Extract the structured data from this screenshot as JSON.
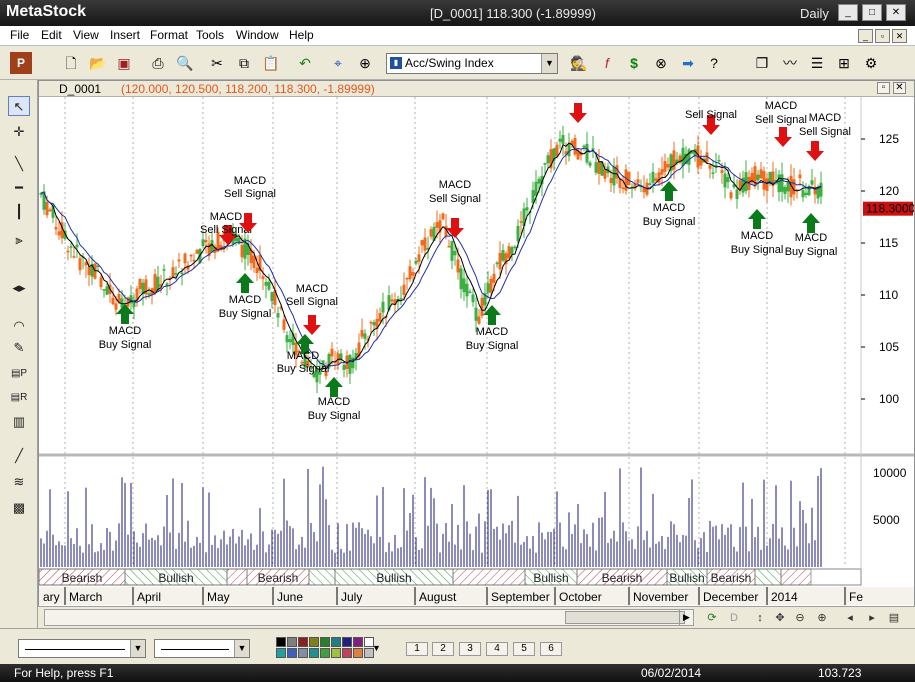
{
  "app": {
    "title": "MetaStock",
    "title_prefix": "Meta",
    "title_suffix": "Stock",
    "document": "[D_0001]   118.300 (-1.89999)",
    "periodicity": "Daily",
    "window_buttons": [
      "_",
      "□",
      "✕"
    ]
  },
  "menu": {
    "items": [
      "File",
      "Edit",
      "View",
      "Insert",
      "Format",
      "Tools",
      "Window",
      "Help"
    ]
  },
  "toolbar": {
    "indicator_combo_value": "Acc/Swing Index"
  },
  "chart": {
    "header_symbol": "D_0001",
    "header_values": "(120.000, 120.500, 118.200, 118.300, -1.89999)",
    "last_price_tag": "118.3000",
    "price_axis": [
      "125",
      "120",
      "115",
      "110",
      "105",
      "100"
    ],
    "volume_axis": [
      "10000",
      "5000"
    ],
    "months": [
      "ary",
      "March",
      "April",
      "May",
      "June",
      "July",
      "August",
      "September",
      "October",
      "November",
      "December",
      "2014",
      "Fe"
    ],
    "trend_bands": [
      {
        "label": "Bearish",
        "kind": "bear"
      },
      {
        "label": "Bullish",
        "kind": "bull"
      },
      {
        "label": "",
        "kind": "bear"
      },
      {
        "label": "Bearish",
        "kind": "bear"
      },
      {
        "label": "",
        "kind": "bull"
      },
      {
        "label": "Bullish",
        "kind": "bull"
      },
      {
        "label": "",
        "kind": "bear"
      },
      {
        "label": "Bullish",
        "kind": "bull"
      },
      {
        "label": "Bearish",
        "kind": "bear"
      },
      {
        "label": "Bullish",
        "kind": "bull"
      },
      {
        "label": "Bearish",
        "kind": "bear"
      },
      {
        "label": "",
        "kind": "bull"
      },
      {
        "label": "",
        "kind": "bear"
      }
    ],
    "signals": [
      {
        "type": "buy",
        "line1": "MACD",
        "line2": "Buy Signal"
      },
      {
        "type": "sell",
        "line1": "MACD",
        "line2": "Sell Signal"
      },
      {
        "type": "sell",
        "line1": "MACD",
        "line2": "Sell Signal"
      },
      {
        "type": "buy",
        "line1": "MACD",
        "line2": "Buy Signal"
      },
      {
        "type": "sell",
        "line1": "MACD",
        "line2": "Sell Signal"
      },
      {
        "type": "buy",
        "line1": "MACD",
        "line2": "Buy Signal"
      },
      {
        "type": "buy",
        "line1": "MACD",
        "line2": "Buy Signal"
      },
      {
        "type": "sell",
        "line1": "MACD",
        "line2": "Sell Signal"
      },
      {
        "type": "buy",
        "line1": "MACD",
        "line2": "Buy Signal"
      },
      {
        "type": "sell",
        "line1": "",
        "line2": ""
      },
      {
        "type": "buy",
        "line1": "MACD",
        "line2": "Buy Signal"
      },
      {
        "type": "sell",
        "line1": "",
        "line2": "Sell Signal"
      },
      {
        "type": "buy",
        "line1": "MACD",
        "line2": "Buy Signal"
      },
      {
        "type": "sell",
        "line1": "MACD",
        "line2": "Sell Signal"
      },
      {
        "type": "sell",
        "line1": "MACD",
        "line2": "Sell Signal"
      },
      {
        "type": "buy",
        "line1": "MACD",
        "line2": "Buy Signal"
      }
    ],
    "colors": {
      "up_bar": "#3cb043",
      "down_bar": "#f26b1d",
      "ma_fast": "#000000",
      "ma_slow": "#1f2fa8",
      "volume": "#1a1a7a",
      "buy_arrow": "#0a7a1a",
      "sell_arrow": "#e01010",
      "price_tag": "#cc1010"
    }
  },
  "status": {
    "help": "For Help, press F1",
    "date": "06/02/2014",
    "value": "103.723"
  }
}
